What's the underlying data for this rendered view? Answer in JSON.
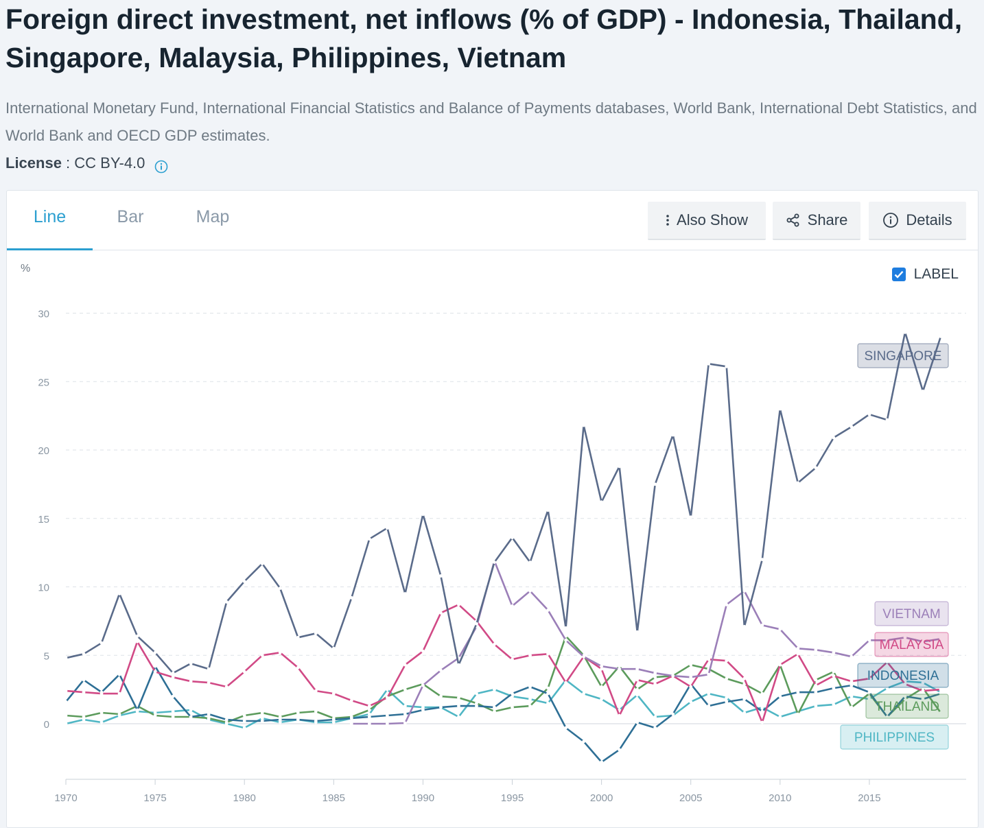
{
  "title": "Foreign direct investment, net inflows (% of GDP) - Indonesia, Thailand, Singapore, Malaysia, Philippines, Vietnam",
  "source": "International Monetary Fund, International Financial Statistics and Balance of Payments databases, World Bank, International Debt Statistics, and World Bank and OECD GDP estimates.",
  "license": {
    "label": "License",
    "separator": " : ",
    "value": "CC BY-4.0",
    "icon": "info-icon"
  },
  "tabs": [
    {
      "label": "Line",
      "active": true
    },
    {
      "label": "Bar",
      "active": false
    },
    {
      "label": "Map",
      "active": false
    }
  ],
  "buttons": {
    "also_show": {
      "label": "Also Show",
      "icon": "more-vertical-icon"
    },
    "share": {
      "label": "Share",
      "icon": "share-icon"
    },
    "details": {
      "label": "Details",
      "icon": "info-icon"
    }
  },
  "label_toggle": {
    "label": "LABEL",
    "checked": true
  },
  "colors": {
    "Singapore": "#5a6b8a",
    "Vietnam": "#9b7fb8",
    "Malaysia": "#d14a86",
    "Indonesia": "#2e6f95",
    "Thailand": "#5c9b5c",
    "Philippines": "#4fb6c4",
    "accent": "#2b9fd0"
  },
  "chart_data": {
    "type": "line",
    "ylabel": "%",
    "ylim": [
      -4,
      31
    ],
    "yticks": [
      0,
      5,
      10,
      15,
      20,
      25,
      30
    ],
    "xlim": [
      1970,
      2019
    ],
    "xticks": [
      1970,
      1975,
      1980,
      1985,
      1990,
      1995,
      2000,
      2005,
      2010,
      2015
    ],
    "grid": true,
    "x": [
      1970,
      1971,
      1972,
      1973,
      1974,
      1975,
      1976,
      1977,
      1978,
      1979,
      1980,
      1981,
      1982,
      1983,
      1984,
      1985,
      1986,
      1987,
      1988,
      1989,
      1990,
      1991,
      1992,
      1993,
      1994,
      1995,
      1996,
      1997,
      1998,
      1999,
      2000,
      2001,
      2002,
      2003,
      2004,
      2005,
      2006,
      2007,
      2008,
      2009,
      2010,
      2011,
      2012,
      2013,
      2014,
      2015,
      2016,
      2017,
      2018,
      2019
    ],
    "series": [
      {
        "name": "SINGAPORE",
        "values": [
          4.8,
          5.1,
          5.9,
          9.5,
          6.4,
          5.2,
          3.7,
          4.4,
          4.0,
          8.9,
          10.4,
          11.7,
          9.9,
          6.3,
          6.6,
          5.5,
          9.2,
          13.5,
          14.3,
          9.5,
          15.3,
          10.8,
          4.3,
          7.3,
          11.8,
          13.6,
          11.8,
          15.6,
          7.0,
          21.8,
          16.2,
          18.8,
          6.7,
          17.5,
          21.1,
          15.1,
          26.3,
          26.1,
          7.1,
          12.0,
          23.0,
          17.6,
          18.7,
          20.9,
          21.7,
          22.6,
          22.2,
          28.6,
          24.3,
          28.3
        ]
      },
      {
        "name": "VIETNAM",
        "values": [
          null,
          null,
          null,
          null,
          null,
          null,
          null,
          null,
          null,
          null,
          null,
          null,
          null,
          null,
          null,
          null,
          0.0,
          0.0,
          0.0,
          0.05,
          2.8,
          3.9,
          4.8,
          7.1,
          11.9,
          8.6,
          9.7,
          8.3,
          6.1,
          4.9,
          4.2,
          4.0,
          4.0,
          3.7,
          3.5,
          3.4,
          3.6,
          8.7,
          9.7,
          7.2,
          6.9,
          5.5,
          5.4,
          5.2,
          4.9,
          6.1,
          6.1,
          6.3,
          6.0,
          6.2
        ]
      },
      {
        "name": "MALAYSIA",
        "values": [
          2.4,
          2.3,
          2.2,
          2.2,
          6.0,
          3.8,
          3.4,
          3.1,
          3.0,
          2.7,
          3.8,
          5.0,
          5.2,
          4.1,
          2.4,
          2.2,
          1.7,
          1.3,
          1.9,
          4.3,
          5.3,
          8.1,
          8.7,
          7.5,
          5.8,
          4.7,
          5.0,
          5.1,
          3.0,
          4.9,
          4.0,
          0.6,
          3.2,
          2.9,
          3.5,
          2.7,
          4.7,
          4.6,
          3.3,
          0.1,
          4.3,
          5.1,
          2.8,
          3.5,
          3.1,
          3.3,
          4.5,
          2.9,
          2.4,
          2.5
        ]
      },
      {
        "name": "INDONESIA",
        "values": [
          1.6,
          3.2,
          2.3,
          3.6,
          1.0,
          4.2,
          2.0,
          0.5,
          0.7,
          0.3,
          0.2,
          0.2,
          0.3,
          0.3,
          0.2,
          0.3,
          0.4,
          0.5,
          0.6,
          0.7,
          1.0,
          1.2,
          1.3,
          1.3,
          1.2,
          2.2,
          2.7,
          2.2,
          -0.3,
          -1.3,
          -2.8,
          -1.9,
          0.1,
          -0.3,
          0.7,
          2.9,
          1.3,
          1.6,
          1.8,
          0.9,
          2.0,
          2.3,
          2.3,
          2.6,
          2.8,
          2.3,
          0.5,
          2.0,
          1.8,
          2.2
        ]
      },
      {
        "name": "THAILAND",
        "values": [
          0.6,
          0.5,
          0.8,
          0.7,
          1.3,
          0.6,
          0.5,
          0.5,
          0.4,
          0.1,
          0.6,
          0.8,
          0.5,
          0.8,
          0.9,
          0.4,
          0.5,
          1.0,
          2.0,
          2.5,
          2.9,
          2.0,
          1.9,
          1.5,
          0.9,
          1.2,
          1.3,
          2.6,
          6.4,
          5.0,
          2.7,
          4.2,
          2.5,
          3.4,
          3.5,
          4.3,
          4.0,
          3.3,
          2.9,
          2.2,
          4.3,
          0.7,
          3.2,
          3.8,
          1.2,
          2.2,
          0.5,
          1.8,
          2.6,
          0.8
        ]
      },
      {
        "name": "PHILIPPINES",
        "values": [
          0.0,
          0.3,
          0.1,
          0.6,
          0.9,
          0.8,
          0.9,
          1.0,
          0.3,
          0.0,
          -0.3,
          0.4,
          0.1,
          0.3,
          0.1,
          0.1,
          0.4,
          0.7,
          2.5,
          1.3,
          1.2,
          1.2,
          0.5,
          2.2,
          2.5,
          2.0,
          1.8,
          1.5,
          3.2,
          2.2,
          1.8,
          1.0,
          2.1,
          0.5,
          0.6,
          1.6,
          2.2,
          1.9,
          0.8,
          1.2,
          0.5,
          0.9,
          1.3,
          1.4,
          2.0,
          1.8,
          2.6,
          3.1,
          3.0,
          2.3
        ]
      }
    ]
  }
}
